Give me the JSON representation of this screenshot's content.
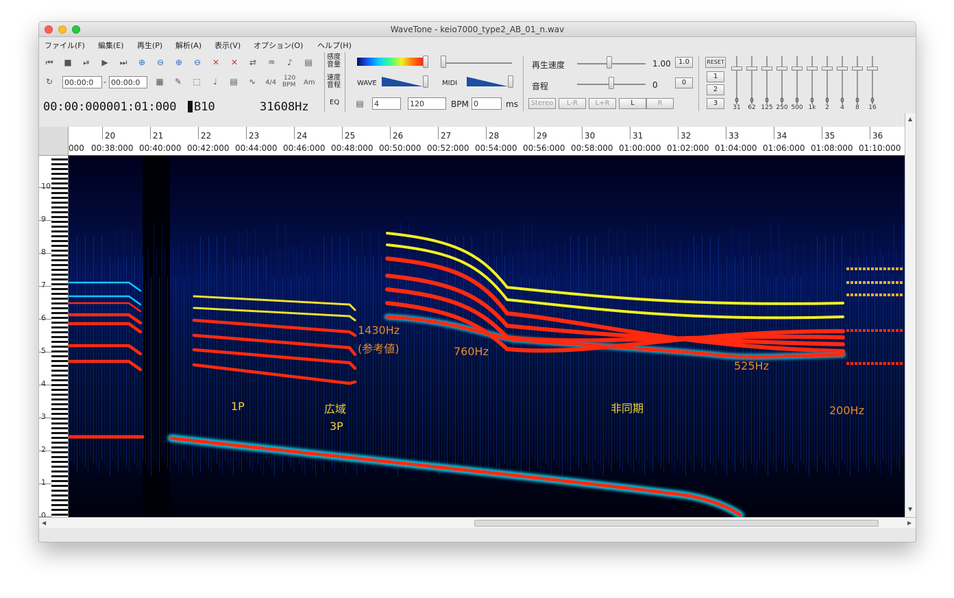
{
  "window": {
    "title": "WaveTone - keio7000_type2_AB_01_n.wav"
  },
  "menu": [
    {
      "label": "ファイル(F)"
    },
    {
      "label": "編集(E)"
    },
    {
      "label": "再生(P)"
    },
    {
      "label": "解析(A)"
    },
    {
      "label": "表示(V)"
    },
    {
      "label": "オプション(O)"
    },
    {
      "label": "ヘルプ(H)"
    }
  ],
  "toolbar": {
    "loop_start": "00:00:0",
    "loop_end": "00:00:0",
    "time_sig": "4/4",
    "bpm_icon_value": "120",
    "bpm_icon_label": "BPM",
    "am_label": "Am",
    "position_display": "00:00:000001:01:000",
    "note_display": "B10",
    "freq_display": "31608Hz",
    "eq_label": "EQ",
    "sens_volume_label_1": "感度",
    "sens_volume_label_2": "音量",
    "speed_pitch_label_1": "速度",
    "speed_pitch_label_2": "音程",
    "wave_label": "WAVE",
    "midi_label": "MIDI",
    "beats_value": "4",
    "bpm_value": "120",
    "bpm_label": "BPM",
    "offset_value": "0",
    "ms_label": "ms",
    "speed_label": "再生速度",
    "speed_value": "1.00",
    "speed_reset": "1.0",
    "pitch_label": "音程",
    "pitch_value": "0",
    "pitch_reset": "0",
    "stereo_label": "Stereo",
    "lr_minus": "L-R",
    "lr_plus": "L+R",
    "left_label": "L",
    "right_label": "R",
    "reset_label": "RESET",
    "preset_1": "1",
    "preset_2": "2",
    "preset_3": "3"
  },
  "equalizer": {
    "values": [
      "0",
      "0",
      "0",
      "0",
      "0",
      "0",
      "0",
      "0",
      "0",
      "0"
    ],
    "bands": [
      "31",
      "62",
      "125",
      "250",
      "500",
      "1k",
      "2",
      "4",
      "8",
      "16"
    ]
  },
  "ruler": {
    "beats": [
      "20",
      "21",
      "22",
      "23",
      "24",
      "25",
      "26",
      "27",
      "28",
      "29",
      "30",
      "31",
      "32",
      "33",
      "34",
      "35",
      "36"
    ],
    "times": [
      "000",
      "00:38:000",
      "00:40:000",
      "00:42:000",
      "00:44:000",
      "00:46:000",
      "00:48:000",
      "00:50:000",
      "00:52:000",
      "00:54:000",
      "00:56:000",
      "00:58:000",
      "01:00:000",
      "01:02:000",
      "01:04:000",
      "01:06:000",
      "01:08:000",
      "01:10:000"
    ]
  },
  "piano": {
    "octaves": [
      "10",
      "9",
      "8",
      "7",
      "6",
      "5",
      "4",
      "3",
      "2",
      "1",
      "0"
    ]
  },
  "annotations": {
    "f1430": "1430Hz",
    "ref": "(参考値)",
    "f760": "760Hz",
    "f525": "525Hz",
    "f200": "200Hz",
    "p1": "1P",
    "wide": "広域",
    "p3": "3P",
    "async": "非同期"
  },
  "colors": {
    "spectrogram_bg": "#00001a",
    "harmonic_red": "#ff2a10",
    "annotation_orange": "#e58a2b",
    "annotation_yellow": "#f0d23a"
  }
}
